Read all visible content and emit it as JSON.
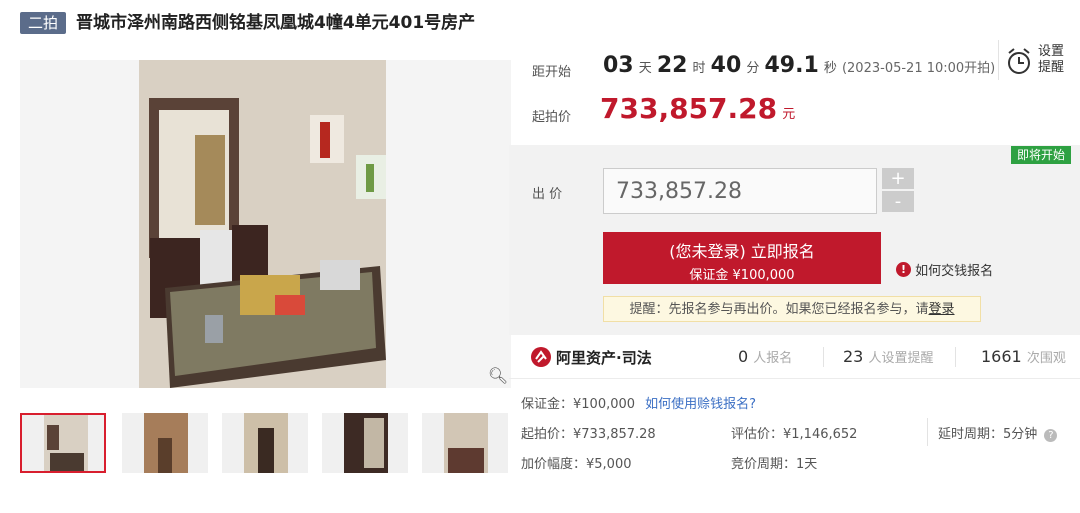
{
  "header": {
    "round_tag": "二拍",
    "title": "晋城市泽州南路西侧铭基凤凰城4幢4单元401号房产"
  },
  "countdown": {
    "label": "距开始",
    "days": "03",
    "days_unit": "天",
    "hours": "22",
    "hours_unit": "时",
    "minutes": "40",
    "minutes_unit": "分",
    "seconds": "49.1",
    "seconds_unit": "秒",
    "start_note": "(2023-05-21 10:00开拍)"
  },
  "remind": {
    "line1": "设置",
    "line2": "提醒"
  },
  "start_price": {
    "label": "起拍价",
    "value": "733,857.28",
    "unit": "元"
  },
  "status_badge": "即将开始",
  "bid": {
    "label": "出 价",
    "value": "733,857.28",
    "plus": "+",
    "minus": "-"
  },
  "signup": {
    "line1": "(您未登录) 立即报名",
    "line2": "保证金 ¥100,000",
    "offline_help": "如何交钱报名"
  },
  "reminder": {
    "text": "提醒：先报名参与再出价。如果您已经报名参与，请",
    "login_link": "登录"
  },
  "platform": {
    "name": "阿里资产·司法",
    "signups_count": "0",
    "signups_label": "人报名",
    "reminders_count": "23",
    "reminders_label": "人设置提醒",
    "views_count": "1661",
    "views_label": "次围观"
  },
  "details": {
    "deposit": "保证金：¥100,000",
    "deposit_help": "如何使用赊钱报名?",
    "start_price": "起拍价：¥733,857.28",
    "appraisal": "评估价：¥1,146,652",
    "delay": "延时周期：5分钟",
    "increment": "加价幅度：¥5,000",
    "cycle": "竞价周期：1天"
  },
  "colors": {
    "accent": "#c0192c",
    "badge_green": "#2ea142",
    "tag_blue": "#5b6c8a",
    "link": "#3b6fc4"
  }
}
